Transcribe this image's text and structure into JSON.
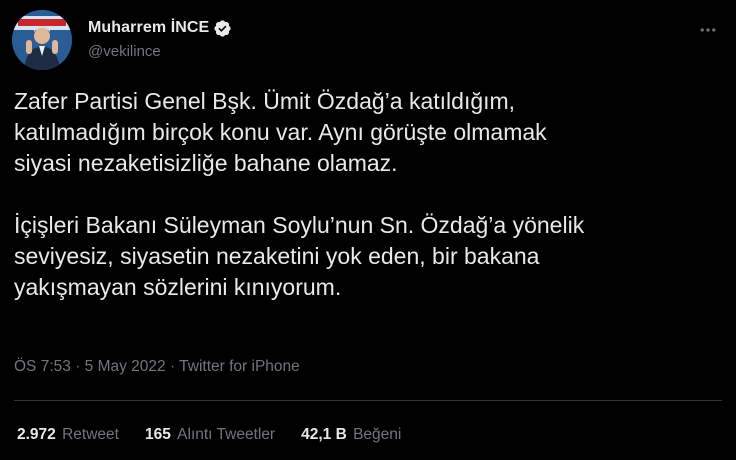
{
  "author": {
    "display_name": "Muharrem İNCE",
    "username": "@vekilince",
    "verified": true,
    "avatar_icon": "profile-photo"
  },
  "tweet": {
    "paragraphs": [
      [
        "Zafer Partisi Genel Bşk. Ümit Özdağ’a katıldığım,",
        "katılmadığım birçok konu var. Aynı görüşte olmamak",
        "siyasi nezaketisizliğe bahane olamaz."
      ],
      [
        "İçişleri Bakanı Süleyman Soylu’nun Sn. Özdağ’a yönelik",
        "seviyesiz, siyasetin nezaketini yok eden, bir bakana",
        "yakışmayan sözlerini kınıyorum."
      ]
    ]
  },
  "meta": {
    "time": "ÖS 7:53",
    "separator": " · ",
    "date": "5 May 2022",
    "source": "Twitter for iPhone"
  },
  "stats": {
    "retweets": {
      "count": "2.972",
      "label": "Retweet"
    },
    "quotes": {
      "count": "165",
      "label": "Alıntı Tweetler"
    },
    "likes": {
      "count": "42,1 B",
      "label": "Beğeni"
    }
  },
  "colors": {
    "background": "#000000",
    "text_primary": "#e7e9ea",
    "text_secondary": "#71767b",
    "divider": "#2f3336",
    "verified_badge": "#e7e9ea"
  }
}
